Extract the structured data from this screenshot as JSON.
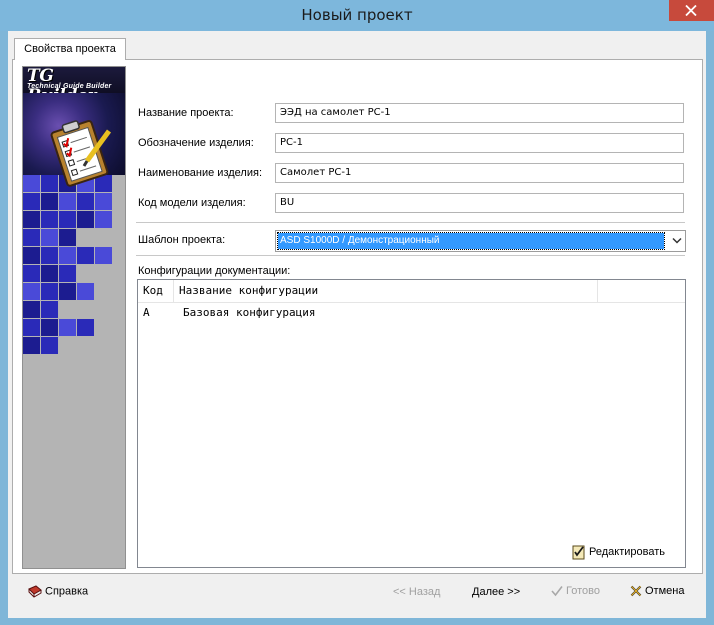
{
  "window": {
    "title": "Новый проект"
  },
  "tab": {
    "label": "Свойства проекта"
  },
  "logo": {
    "main": "TG Builder",
    "sub": "Technical Guide Builder"
  },
  "form": {
    "project_name_label": "Название проекта:",
    "project_name_value": "ЭЭД на самолет РС-1",
    "designation_label": "Обозначение изделия:",
    "designation_value": "РС-1",
    "product_name_label": "Наименование изделия:",
    "product_name_value": "Самолет РС-1",
    "model_code_label": "Код модели изделия:",
    "model_code_value": "BU",
    "template_label": "Шаблон проекта:",
    "template_value": "ASD S1000D / Демонстрационный",
    "configs_label": "Конфигурации документации:"
  },
  "configs": {
    "columns": [
      "Код",
      "Название конфигурации"
    ],
    "rows": [
      {
        "code": "A",
        "name": "Базовая конфигурация"
      }
    ]
  },
  "buttons": {
    "edit": "Редактировать",
    "help": "Справка",
    "back": "<< Назад",
    "next": "Далее >>",
    "done": "Готово",
    "cancel": "Отмена"
  }
}
